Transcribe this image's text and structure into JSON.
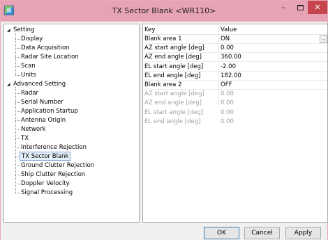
{
  "window": {
    "title": "TX Sector Blank <WR110>",
    "controls": {
      "minimize": "–",
      "close": "✕"
    },
    "colors": {
      "titlebar": "#e7a3b6",
      "close_button": "#c7454e",
      "selection_border": "#7fa8d8"
    }
  },
  "tree": {
    "groups": [
      {
        "label": "Setting",
        "expanded": true,
        "items": [
          "Display",
          "Data Acquisition",
          "Radar Site Location",
          "Scan",
          "Units"
        ]
      },
      {
        "label": "Advanced Setting",
        "expanded": true,
        "items": [
          "Radar",
          "Serial Number",
          "Application Startup",
          "Antenna Origin",
          "Network",
          "TX",
          "Interference Rejection",
          "TX Sector Blank",
          "Ground Clutter Rejection",
          "Ship Clutter Rejection",
          "Doppler Velocity",
          "Signal Processing"
        ]
      }
    ],
    "selected": "TX Sector Blank",
    "expand_glyph": "◢"
  },
  "grid": {
    "columns": [
      "Key",
      "Value"
    ],
    "rows": [
      {
        "key": "Blank area 1",
        "value": "ON",
        "enabled": true,
        "dropdown": true
      },
      {
        "key": "AZ start angle [deg]",
        "value": "0.00",
        "enabled": true
      },
      {
        "key": "AZ end angle [deg]",
        "value": "360.00",
        "enabled": true
      },
      {
        "key": "EL start angle [deg]",
        "value": "-2.00",
        "enabled": true
      },
      {
        "key": "EL end angle [deg]",
        "value": "182.00",
        "enabled": true
      },
      {
        "key": "Blank area 2",
        "value": "OFF",
        "enabled": true
      },
      {
        "key": "AZ start angle [deg]",
        "value": "0.00",
        "enabled": false
      },
      {
        "key": "AZ end angle [deg]",
        "value": "0.00",
        "enabled": false
      },
      {
        "key": "EL start angle [deg]",
        "value": "0.00",
        "enabled": false
      },
      {
        "key": "EL end angle [deg]",
        "value": "0.00",
        "enabled": false
      }
    ],
    "dropdown_glyph": "⌄"
  },
  "footer": {
    "ok_label": "OK",
    "cancel_label": "Cancel",
    "apply_label": "Apply"
  }
}
